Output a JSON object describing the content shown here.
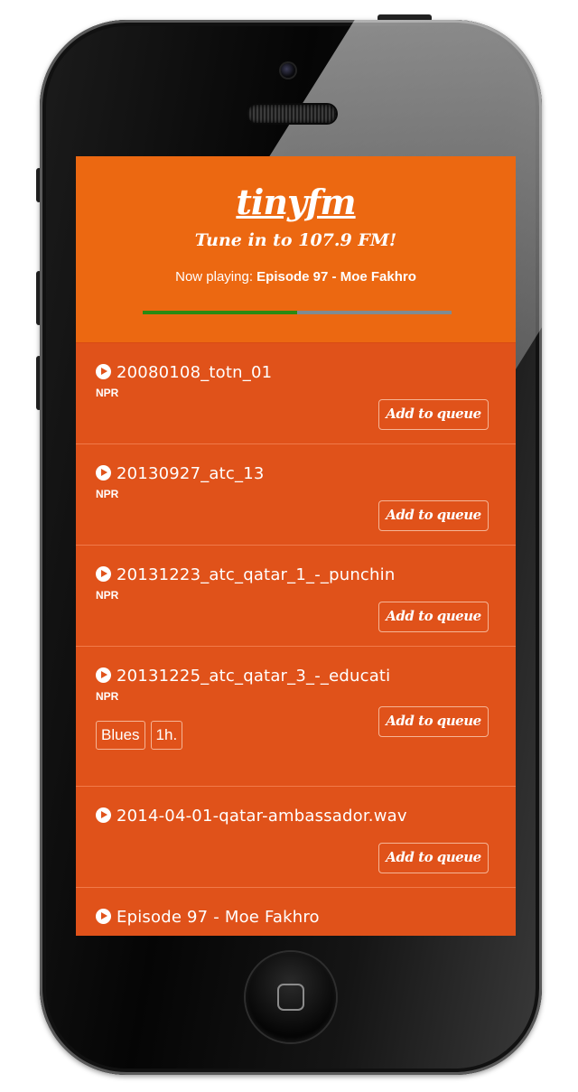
{
  "app": {
    "logo": "tinyfm",
    "tagline": "Tune in to 107.9 FM!",
    "now_playing_label": "Now playing:",
    "now_playing_title": "Episode 97 - Moe Fakhro",
    "progress": 0.5
  },
  "queue_button_label": "Add to queue",
  "tracks": [
    {
      "title": "20080108_totn_01",
      "author": "NPR",
      "tags": []
    },
    {
      "title": "20130927_atc_13",
      "author": "NPR",
      "tags": []
    },
    {
      "title": "20131223_atc_qatar_1_-_punchin",
      "author": "NPR",
      "tags": []
    },
    {
      "title": "20131225_atc_qatar_3_-_educati",
      "author": "NPR",
      "tags": [
        "Blues",
        "1h."
      ]
    },
    {
      "title": "2014-04-01-qatar-ambassador.wav",
      "author": "",
      "tags": []
    },
    {
      "title": "Episode 97 - Moe Fakhro",
      "author": "",
      "tags": []
    }
  ],
  "colors": {
    "header": "#ec6811",
    "list": "#e0521a",
    "progress_played": "#2a8a12",
    "progress_remaining": "#7f8b92"
  },
  "icons": [
    "play-icon",
    "camera-icon",
    "speaker-icon",
    "home-square-icon"
  ]
}
